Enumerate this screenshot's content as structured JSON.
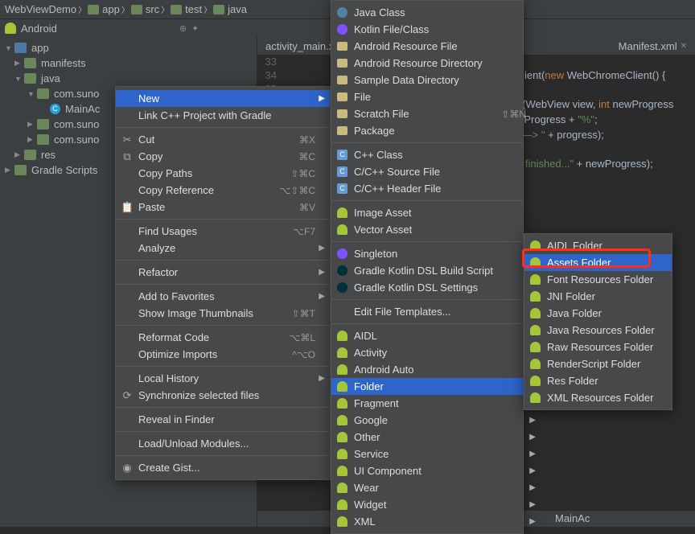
{
  "breadcrumb": [
    "WebViewDemo",
    "app",
    "src",
    "test",
    "java"
  ],
  "toolbarLabel": "Android",
  "tree": {
    "root": "app",
    "items": [
      {
        "l": 1,
        "t": "manifests",
        "a": "▶"
      },
      {
        "l": 1,
        "t": "java",
        "a": "▼"
      },
      {
        "l": 2,
        "t": "com.suno",
        "a": "▼",
        "pkg": true
      },
      {
        "l": 3,
        "t": "MainAc",
        "cls": true
      },
      {
        "l": 2,
        "t": "com.suno",
        "a": "▶",
        "pkg": true
      },
      {
        "l": 2,
        "t": "com.suno",
        "a": "▶",
        "pkg": true
      },
      {
        "l": 1,
        "t": "res",
        "a": "▶"
      },
      {
        "l": 0,
        "t": "Gradle Scripts",
        "a": "▶",
        "grad": true
      }
    ]
  },
  "editorTabs": [
    "activity_main.x",
    "Manifest.xml"
  ],
  "gutterLines": [
    "33",
    "34",
    "35"
  ],
  "code": {
    "l1": "ient(",
    "l1k": "new",
    "l1t": " WebChromeClient() {",
    "l2": "d(WebView view, ",
    "l2k": "int",
    "l2t": " newProgress",
    "l3": "wProgress + ",
    "l3s": "\"%\"",
    "l3t": ";",
    "l4": "\"Progress—> \"",
    "l4t": " + progress);",
    "l5": "d finished...\"",
    "l5t": " + newProgress);"
  },
  "statusbar": "MainAc",
  "ctxMain": {
    "new": "New",
    "linkcpp": "Link C++ Project with Gradle",
    "cut": {
      "label": "Cut",
      "sc": "⌘X"
    },
    "copy": {
      "label": "Copy",
      "sc": "⌘C"
    },
    "copypaths": {
      "label": "Copy Paths",
      "sc": "⇧⌘C"
    },
    "copyref": {
      "label": "Copy Reference",
      "sc": "⌥⇧⌘C"
    },
    "paste": {
      "label": "Paste",
      "sc": "⌘V"
    },
    "findusages": {
      "label": "Find Usages",
      "sc": "⌥F7"
    },
    "analyze": "Analyze",
    "refactor": "Refactor",
    "addfav": "Add to Favorites",
    "showthumb": {
      "label": "Show Image Thumbnails",
      "sc": "⇧⌘T"
    },
    "reformat": {
      "label": "Reformat Code",
      "sc": "⌥⌘L"
    },
    "optimports": {
      "label": "Optimize Imports",
      "sc": "^⌥O"
    },
    "localhist": "Local History",
    "sync": "Synchronize selected files",
    "reveal": "Reveal in Finder",
    "modules": "Load/Unload Modules...",
    "gist": "Create Gist..."
  },
  "ctxNew": [
    {
      "label": "Java Class",
      "ic": "j"
    },
    {
      "label": "Kotlin File/Class",
      "ic": "k"
    },
    {
      "label": "Android Resource File",
      "ic": "f"
    },
    {
      "label": "Android Resource Directory",
      "ic": "f"
    },
    {
      "label": "Sample Data Directory",
      "ic": "f"
    },
    {
      "label": "File",
      "ic": "f"
    },
    {
      "label": "Scratch File",
      "ic": "f",
      "sc": "⇧⌘N"
    },
    {
      "label": "Package",
      "ic": "f"
    },
    {
      "sep": true
    },
    {
      "label": "C++ Class",
      "ic": "c"
    },
    {
      "label": "C/C++ Source File",
      "ic": "c"
    },
    {
      "label": "C/C++ Header File",
      "ic": "c"
    },
    {
      "sep": true
    },
    {
      "label": "Image Asset",
      "ic": "a"
    },
    {
      "label": "Vector Asset",
      "ic": "a"
    },
    {
      "sep": true
    },
    {
      "label": "Singleton",
      "ic": "k"
    },
    {
      "label": "Gradle Kotlin DSL Build Script",
      "ic": "g"
    },
    {
      "label": "Gradle Kotlin DSL Settings",
      "ic": "g"
    },
    {
      "sep": true
    },
    {
      "label": "Edit File Templates..."
    },
    {
      "sep": true
    },
    {
      "label": "AIDL",
      "ic": "a",
      "sub": true
    },
    {
      "label": "Activity",
      "ic": "a",
      "sub": true
    },
    {
      "label": "Android Auto",
      "ic": "a",
      "sub": true
    },
    {
      "label": "Folder",
      "ic": "a",
      "sub": true,
      "sel": true
    },
    {
      "label": "Fragment",
      "ic": "a",
      "sub": true
    },
    {
      "label": "Google",
      "ic": "a",
      "sub": true
    },
    {
      "label": "Other",
      "ic": "a",
      "sub": true
    },
    {
      "label": "Service",
      "ic": "a",
      "sub": true
    },
    {
      "label": "UI Component",
      "ic": "a",
      "sub": true
    },
    {
      "label": "Wear",
      "ic": "a",
      "sub": true
    },
    {
      "label": "Widget",
      "ic": "a",
      "sub": true
    },
    {
      "label": "XML",
      "ic": "a",
      "sub": true
    }
  ],
  "ctxFolder": [
    {
      "label": "AIDL Folder"
    },
    {
      "label": "Assets Folder",
      "sel": true
    },
    {
      "label": "Font Resources Folder"
    },
    {
      "label": "JNI Folder"
    },
    {
      "label": "Java Folder"
    },
    {
      "label": "Java Resources Folder"
    },
    {
      "label": "Raw Resources Folder"
    },
    {
      "label": "RenderScript Folder"
    },
    {
      "label": "Res Folder"
    },
    {
      "label": "XML Resources Folder"
    }
  ]
}
